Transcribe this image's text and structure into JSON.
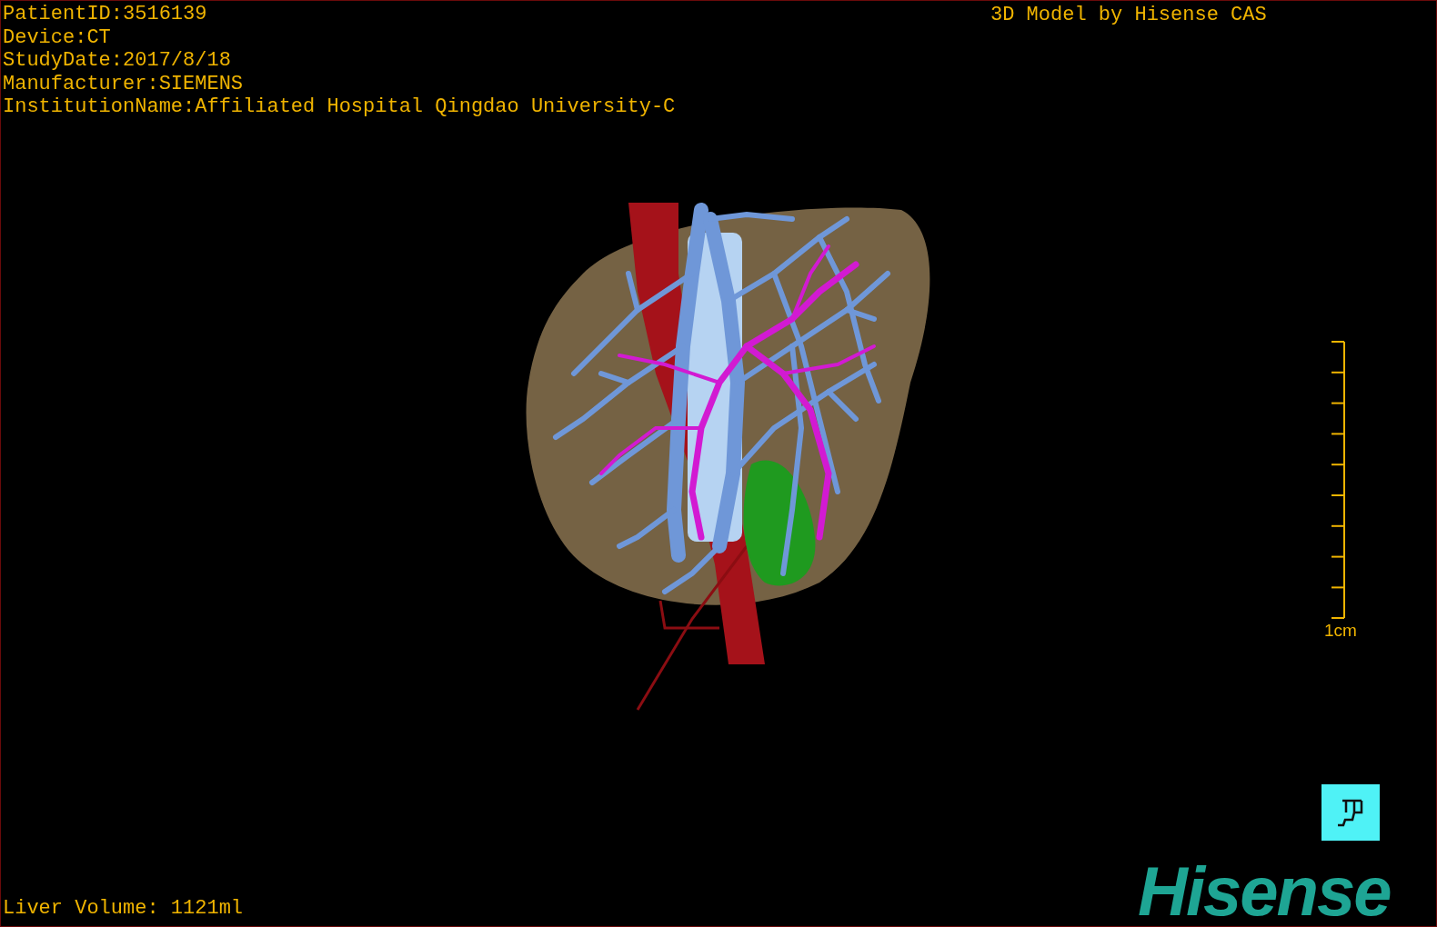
{
  "patient_info": [
    "PatientID:3516139",
    "Device:CT",
    "StudyDate:2017/8/18",
    "Manufacturer:SIEMENS",
    "InstitutionName:Affiliated Hospital Qingdao University-C"
  ],
  "model_credit": "3D Model by Hisense CAS",
  "scale_bar": {
    "label": "1cm"
  },
  "liver_volume": "Liver Volume: 1121ml",
  "logo": "Hisense"
}
